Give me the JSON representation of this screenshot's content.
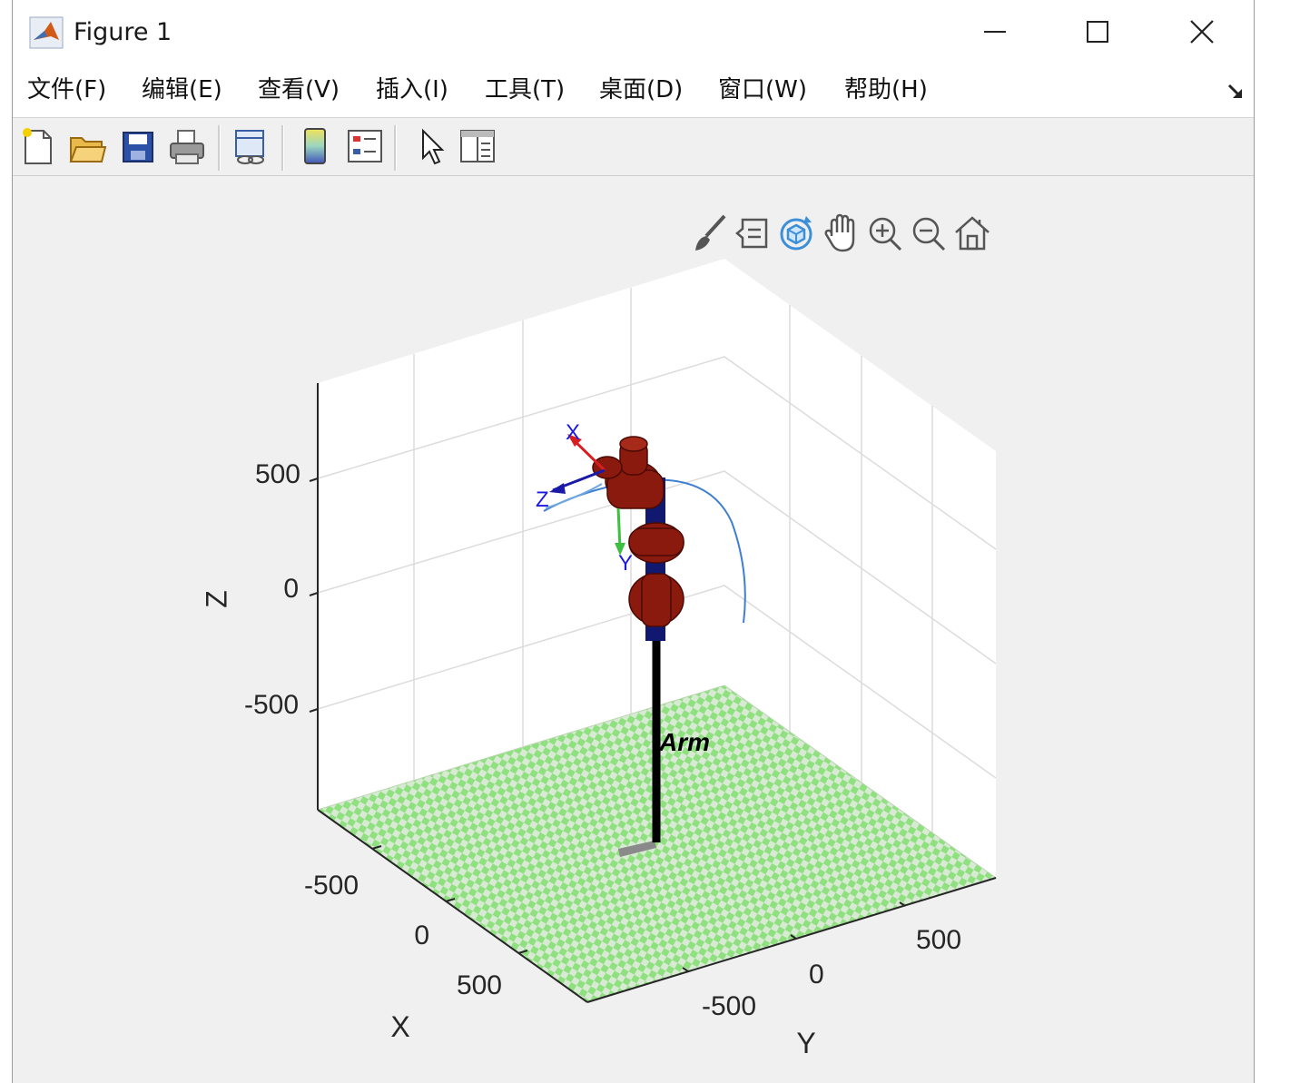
{
  "window": {
    "title": "Figure 1"
  },
  "menu": [
    "文件(F)",
    "编辑(E)",
    "查看(V)",
    "插入(I)",
    "工具(T)",
    "桌面(D)",
    "窗口(W)",
    "帮助(H)"
  ],
  "toolbar_icons": [
    "new-figure-icon",
    "open-file-icon",
    "save-icon",
    "print-icon",
    "link-plot-icon",
    "colorbar-icon",
    "legend-icon",
    "pointer-icon",
    "property-inspector-icon"
  ],
  "axes_toolbar_icons": [
    "brush-icon",
    "data-tip-icon",
    "rotate-3d-icon",
    "pan-icon",
    "zoom-in-icon",
    "zoom-out-icon",
    "home-icon"
  ],
  "plot": {
    "zlabel": "Z",
    "xlabel": "X",
    "ylabel": "Y",
    "z_ticks": [
      "500",
      "0",
      "-500"
    ],
    "x_ticks": [
      "-500",
      "0",
      "500"
    ],
    "y_ticks": [
      "500",
      "0",
      "-500"
    ],
    "robot_name": "Arm",
    "frame_labels": [
      "X",
      "Z",
      "Y"
    ],
    "colors": {
      "floor_green": "#8fe07f",
      "link_red": "#8b1a0e",
      "joint_navy": "#101870",
      "trajectory": "#3f7fd0",
      "pedestal": "#000000"
    }
  }
}
